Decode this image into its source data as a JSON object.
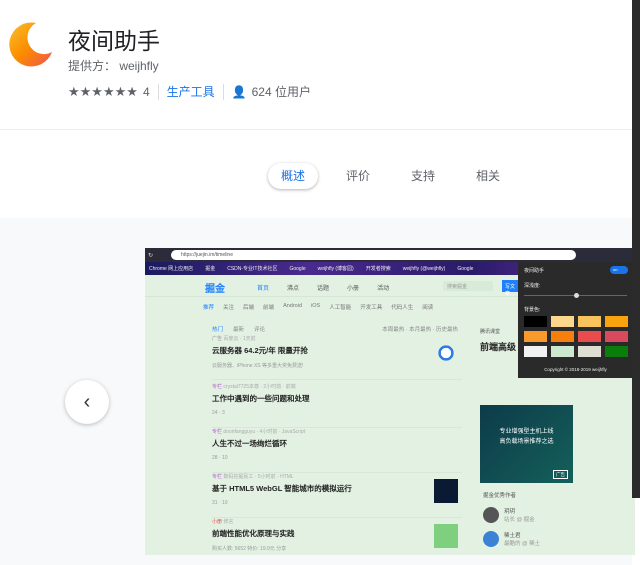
{
  "extension": {
    "name": "夜间助手",
    "provider": "提供方： weijhfly",
    "rating": "4",
    "stars": "★★★★★★",
    "category": "生产工具",
    "users": "624 位用户"
  },
  "tabs": [
    {
      "label": "概述"
    },
    {
      "label": "评价"
    },
    {
      "label": "支持"
    },
    {
      "label": "相关"
    }
  ],
  "screenshot": {
    "url": "https://juejin.im/timeline",
    "bookmarks": [
      "Chrome 网上应用店",
      "掘金",
      "CSDN-专业IT技术社区",
      "Google",
      "weijhfly (博客园)",
      "开发者搜索",
      "weijhfly (@weijhfly)",
      "Google"
    ],
    "site_logo": "掘金",
    "nav": [
      "首页",
      "沸点",
      "话题",
      "小册",
      "活动"
    ],
    "search_placeholder": "搜索掘金",
    "write_btn": "写文章",
    "subnav": [
      "推荐",
      "关注",
      "后端",
      "前端",
      "Android",
      "iOS",
      "人工智能",
      "开发工具",
      "代码人生",
      "阅读"
    ],
    "feed_tabs": [
      "热门",
      "最新",
      "评论"
    ],
    "feed_ranks": "本周最热 · 本月最热 · 历史最热",
    "items": [
      {
        "meta_tag": "广告",
        "meta": "百度云 · 1天前",
        "title": "云服务器 64.2元/年 限量开抢",
        "sub": "云服务器、iPhone XS 等多重大奖免费送!"
      },
      {
        "meta_tag": "专栏",
        "meta": "crystal7725本尊 · 2小时前 · 前端",
        "title": "工作中遇到的一些问题和处理",
        "sub": "24 · 3"
      },
      {
        "meta_tag": "专栏",
        "meta": "doonfangguyu · 4小时前 · JavaScript",
        "title": "人生不过一场绚烂循环",
        "sub": "28 · 10"
      },
      {
        "meta_tag": "专栏",
        "meta": "数码挖掘民工 · 5小时前 · HTML",
        "title": "基于 HTML5 WebGL 智能城市的模拟运行",
        "sub": "31 · 10"
      },
      {
        "meta_tag": "小册",
        "meta": "修言",
        "title": "前端性能优化原理与实践",
        "sub": "购买人数: 5652   特价: 19.9元   分享"
      }
    ],
    "side_title": "前端高级",
    "side_source": "腾讯课堂",
    "ad_text": "专业增强型主机上线\n高负载场景推荐之选",
    "ad_label": "广告",
    "authors_title": "掘金优秀作者",
    "authors": [
      {
        "name": "玥玥",
        "desc": "站长 @ 掘金"
      },
      {
        "name": "稀土君",
        "desc": "最酷的 @ 稀土"
      }
    ],
    "popup": {
      "title": "夜间助手",
      "toggle": "on",
      "depth_label": "深浅度:",
      "bg_label": "背景色:",
      "copyright": "Copyright © 2018-2019 weijhfly",
      "depth": 0.5,
      "swatches": [
        "#000000",
        "#fcd68a",
        "#f8c35d",
        "#f9a30f",
        "#f99a2c",
        "#f77f0e",
        "#e84c4c",
        "#d94a5e",
        "#f2f2f2",
        "#cce8cf",
        "#deded2",
        "#0a7d0a"
      ]
    }
  }
}
